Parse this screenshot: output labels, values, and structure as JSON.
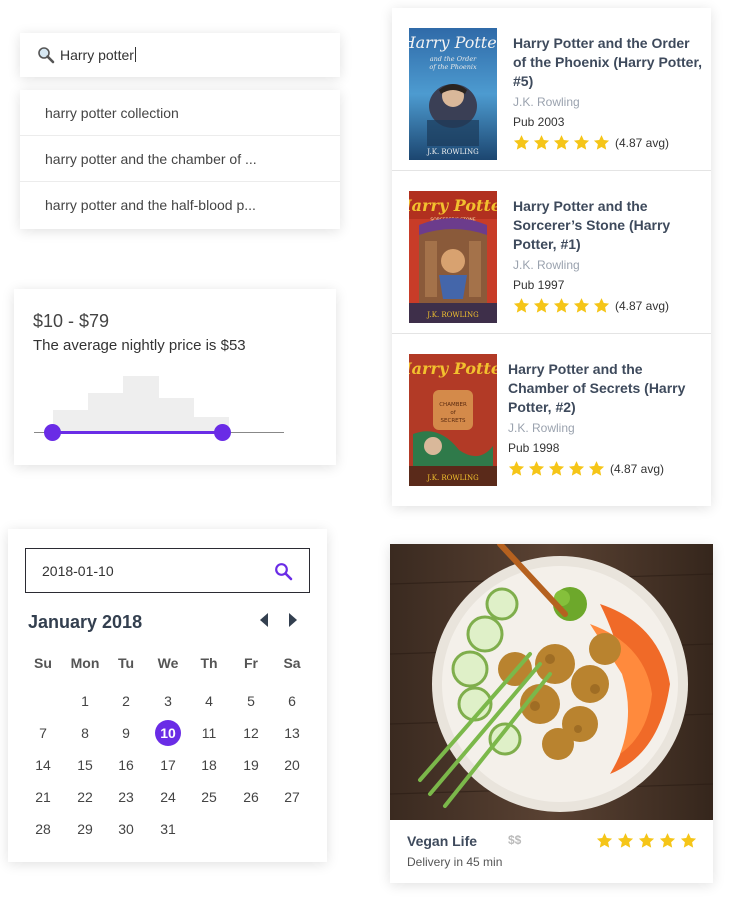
{
  "search": {
    "query": "Harry potter",
    "suggestions": [
      "harry potter collection",
      "harry potter and the chamber of ...",
      "harry potter and the half-blood p..."
    ]
  },
  "price": {
    "range": "$10 - $79",
    "average": "The average nightly price is $53",
    "histogram": [
      0.4,
      0.71,
      1.0,
      0.62,
      0.28
    ],
    "selected_min": 0.0,
    "selected_max": 1.0
  },
  "calendar": {
    "date_value": "2018-01-10",
    "month": "January 2018",
    "weekdays": [
      "Su",
      "Mon",
      "Tu",
      "We",
      "Th",
      "Fr",
      "Sa"
    ],
    "first_weekday": 1,
    "days_in_month": 31,
    "selected_day": 10
  },
  "books": [
    {
      "title": "Harry Potter and the Order of the Phoenix (Harry Potter, #5)",
      "author": "J.K. Rowling",
      "pub": "Pub 2003",
      "rating": 5,
      "avg": "(4.87 avg)",
      "cover_logo": "Harry Potter",
      "cover_subtitle": "and the Order of the Phoenix",
      "cover_author": "J.K. ROWLING"
    },
    {
      "title": "Harry Potter and the Sorcerer’s Stone (Harry Potter, #1)",
      "author": "J.K. Rowling",
      "pub": "Pub 1997",
      "rating": 5,
      "avg": "(4.87 avg)",
      "cover_logo": "Harry Potter",
      "cover_subtitle": "SORCERER'S STONE",
      "cover_author": "J.K. ROWLING"
    },
    {
      "title": "Harry Potter and the Chamber of Secrets (Harry Potter, #2)",
      "author": "J.K. Rowling",
      "pub": "Pub 1998",
      "rating": 5,
      "avg": "(4.87 avg)",
      "cover_logo": "Harry Potter",
      "cover_subtitle": "CHAMBER of SECRETS",
      "cover_author": "J.K. ROWLING"
    }
  ],
  "food": {
    "name": "Vegan Life",
    "price_level": "$$",
    "delivery": "Delivery in 45 min",
    "rating": 5
  },
  "colors": {
    "accent": "#6a2ce6",
    "star": "#f5c518",
    "title": "#3e4a5c"
  }
}
